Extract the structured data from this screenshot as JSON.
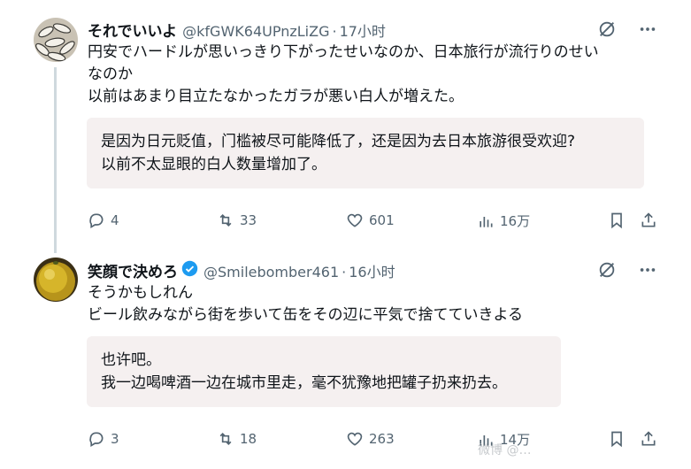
{
  "tweets": [
    {
      "name": "それでいいよ",
      "handle": "@kfGWK64UPnzLiZG",
      "time": "17小时",
      "text": "円安でハードルが思いっきり下がったせいなのか、日本旅行が流行りのせい\nなのか\n以前はあまり目立たなかったガラが悪い白人が増えた。",
      "translation": "是因为日元贬值，门槛被尽可能降低了，还是因为去日本旅游很受欢迎?\n以前不太显眼的白人数量增加了。",
      "replies": "4",
      "retweets": "33",
      "likes": "601",
      "views": "16万"
    },
    {
      "name": "笑顔で決めろ",
      "handle": "@Smilebomber461",
      "time": "16小时",
      "text": "そうかもしれん\nビール飲みながら街を歩いて缶をその辺に平気で捨てていきよる",
      "translation": "也许吧。\n我一边喝啤酒一边在城市里走，毫不犹豫地把罐子扔来扔去。",
      "replies": "3",
      "retweets": "18",
      "likes": "263",
      "views": "14万"
    }
  ],
  "watermark": "微博 @…",
  "colors": {
    "verified": "#1d9bf0",
    "muted": "#536471",
    "translation_bg": "#f5f0f0"
  }
}
